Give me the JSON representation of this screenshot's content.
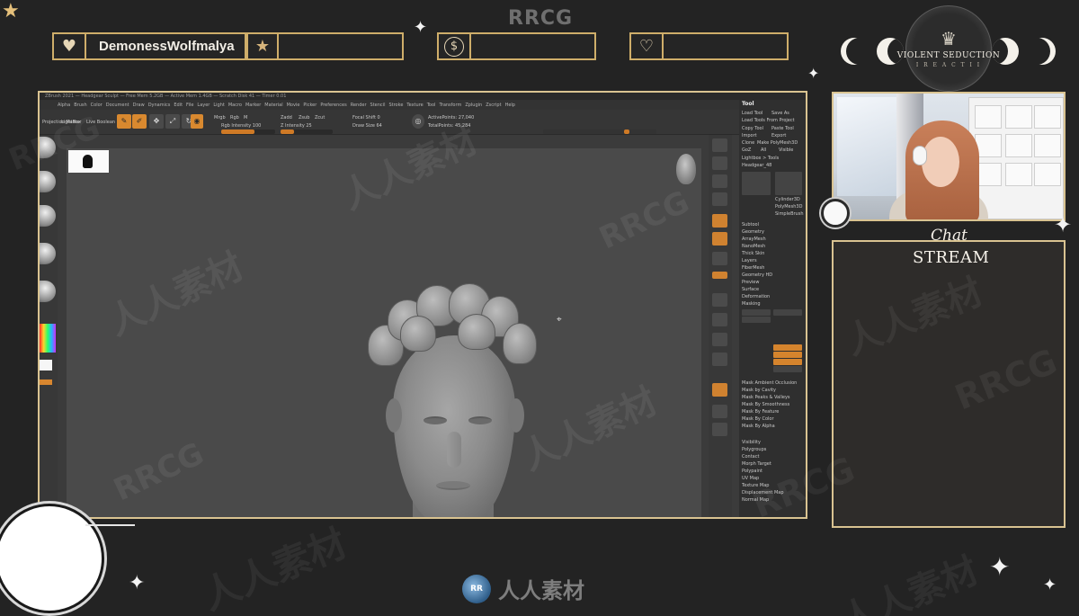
{
  "overlay": {
    "watermark_top": "RRCG",
    "info_boxes": [
      {
        "icon": "heart-icon",
        "glyph": "♥",
        "label": "DemonessWolfmalya"
      },
      {
        "icon": "star-icon",
        "glyph": "★",
        "label": ""
      },
      {
        "icon": "dollar-icon",
        "glyph": "$",
        "label": ""
      },
      {
        "icon": "hand-heart-icon",
        "glyph": "♡",
        "label": ""
      }
    ],
    "logo": {
      "name": "VIOLENT SEDUCTION",
      "sub": "I R E A C T I I",
      "crown": "♛"
    },
    "chat_script": "Chat",
    "chat_title": "STREAM",
    "bottom_logo_badge": "RR",
    "bottom_logo_text": "人人素材",
    "watermarks": [
      "RRCG",
      "人人素材"
    ],
    "accent_color": "#cfae6a"
  },
  "app": {
    "titlebar": "ZBrush 2021 — Headgear Sculpt — Free Mem 5.2GB — Active Mem 1.4GB — Scratch Disk 41 — Timer 0.01",
    "menu": [
      "Alpha",
      "Brush",
      "Color",
      "Document",
      "Draw",
      "Dynamics",
      "Edit",
      "File",
      "Layer",
      "Light",
      "Macro",
      "Marker",
      "Material",
      "Movie",
      "Picker",
      "Preferences",
      "Render",
      "Stencil",
      "Stroke",
      "Texture",
      "Tool",
      "Transform",
      "Zplugin",
      "Zscript",
      "Help"
    ],
    "toolbar": {
      "projection": "Projection Master",
      "lightbox": "LightBox",
      "live_boolean": "Live Boolean",
      "mrgb": "Mrgb",
      "rgb": "Rgb",
      "m": "M",
      "zadd": "Zadd",
      "zsub": "Zsub",
      "zcut": "Zcut",
      "focal_shift": "Focal Shift 0",
      "draw_size": "Draw Size 64",
      "rgb_intensity": "Rgb Intensity 100",
      "z_intensity": "Z Intensity 25",
      "active_points": "ActivePoints: 27,040",
      "total_points": "TotalPoints: 45,284",
      "rgb_intensity_level": 0.62,
      "z_intensity_level": 0.25
    },
    "tool_panel": {
      "title": "Tool",
      "rows": [
        "Load Tool",
        "Save As",
        "Load Tools From Project",
        "Copy Tool",
        "Paste Tool",
        "Import",
        "Export",
        "Clone",
        "Make PolyMesh3D",
        "GoZ",
        "All",
        "Visible",
        "Lightbox > Tools",
        "Headgear_48",
        "Cylinder3D",
        "PolyMesh3D",
        "SimpleBrush",
        "Subtool",
        "Geometry",
        "ArrayMesh",
        "NanoMesh",
        "Thick Skin",
        "Layers",
        "FiberMesh",
        "Geometry HD",
        "Preview",
        "Surface",
        "Deformation",
        "Masking",
        "Mask All",
        "Clear",
        "Inverse",
        "Mask Ambient Occlusion",
        "Mask by Cavity",
        "Mask Peaks & Valleys",
        "Mask By Smoothness",
        "Mask By Feature",
        "Mask By Color",
        "Mask By Alpha",
        "Visibility",
        "Polygroups",
        "Contact",
        "Morph Target",
        "Polypaint",
        "UV Map",
        "Texture Map",
        "Displacement Map",
        "Normal Map"
      ]
    }
  }
}
